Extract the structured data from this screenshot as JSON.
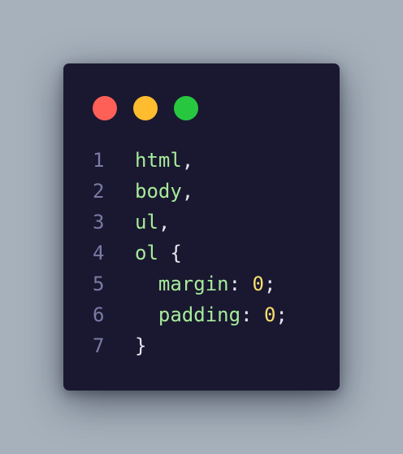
{
  "colors": {
    "page_background": "#a6b1bc",
    "window_background": "#1a1830",
    "dot_close": "#fe5f57",
    "dot_minimize": "#febc2e",
    "dot_maximize": "#27c840",
    "line_number": "#7b7aa6",
    "selector": "#a6eb9a",
    "punctuation": "#e6e6f0",
    "number": "#f7df6f"
  },
  "window_controls": [
    "close-dot",
    "minimize-dot",
    "maximize-dot"
  ],
  "code": {
    "lines": [
      {
        "number": "1",
        "indent": "",
        "tokens": [
          {
            "text": "html",
            "kind": "sel"
          },
          {
            "text": ",",
            "kind": "punc"
          }
        ]
      },
      {
        "number": "2",
        "indent": "",
        "tokens": [
          {
            "text": "body",
            "kind": "sel"
          },
          {
            "text": ",",
            "kind": "punc"
          }
        ]
      },
      {
        "number": "3",
        "indent": "",
        "tokens": [
          {
            "text": "ul",
            "kind": "sel"
          },
          {
            "text": ",",
            "kind": "punc"
          }
        ]
      },
      {
        "number": "4",
        "indent": "",
        "tokens": [
          {
            "text": "ol",
            "kind": "sel"
          },
          {
            "text": " {",
            "kind": "punc"
          }
        ]
      },
      {
        "number": "5",
        "indent": "  ",
        "tokens": [
          {
            "text": "margin",
            "kind": "prop"
          },
          {
            "text": ": ",
            "kind": "punc"
          },
          {
            "text": "0",
            "kind": "num"
          },
          {
            "text": ";",
            "kind": "punc"
          }
        ]
      },
      {
        "number": "6",
        "indent": "  ",
        "tokens": [
          {
            "text": "padding",
            "kind": "prop"
          },
          {
            "text": ": ",
            "kind": "punc"
          },
          {
            "text": "0",
            "kind": "num"
          },
          {
            "text": ";",
            "kind": "punc"
          }
        ]
      },
      {
        "number": "7",
        "indent": "",
        "tokens": [
          {
            "text": "}",
            "kind": "punc"
          }
        ]
      }
    ]
  }
}
